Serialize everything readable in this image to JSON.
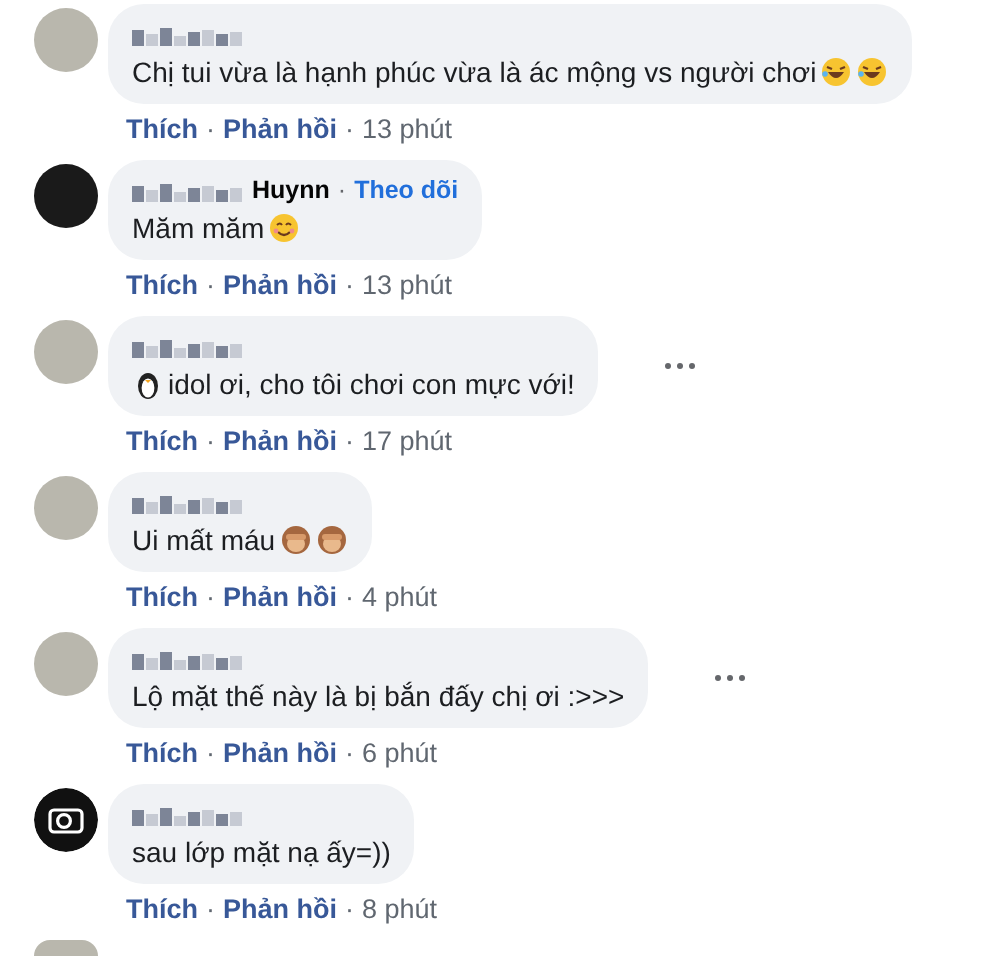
{
  "comments": [
    {
      "kind": "photo",
      "text": "Chị tui vừa là hạnh phúc vừa là ác mộng vs người chơi",
      "emojis": [
        {
          "kind": "rofl"
        },
        {
          "kind": "rofl"
        }
      ],
      "more": false,
      "actions": [
        {
          "kind": "link",
          "text": "Thích"
        },
        {
          "kind": "sep",
          "text": "·"
        },
        {
          "kind": "link",
          "text": "Phản hồi"
        },
        {
          "kind": "sep",
          "text": "·"
        },
        {
          "kind": "time",
          "text": "13 phút"
        }
      ]
    },
    {
      "kind": "dark",
      "name_visible": "Huynn",
      "follow_separator": "·",
      "follow": "Theo dõi",
      "text": "Măm măm",
      "emojis": [
        {
          "kind": "smile"
        }
      ],
      "more": false,
      "actions": [
        {
          "kind": "link",
          "text": "Thích"
        },
        {
          "kind": "sep",
          "text": "·"
        },
        {
          "kind": "link",
          "text": "Phản hồi"
        },
        {
          "kind": "sep",
          "text": "·"
        },
        {
          "kind": "time",
          "text": "13 phút"
        }
      ]
    },
    {
      "kind": "photo",
      "text": "idol ơi, cho tôi chơi con mực với!",
      "lead_emoji": [
        {
          "kind": "penguin"
        }
      ],
      "more": true,
      "actions": [
        {
          "kind": "link",
          "text": "Thích"
        },
        {
          "kind": "sep",
          "text": "·"
        },
        {
          "kind": "link",
          "text": "Phản hồi"
        },
        {
          "kind": "sep",
          "text": "·"
        },
        {
          "kind": "time",
          "text": "17 phút"
        }
      ]
    },
    {
      "kind": "photo",
      "text": "Ui mất máu",
      "emojis": [
        {
          "kind": "monkey"
        },
        {
          "kind": "monkey"
        }
      ],
      "more": false,
      "actions": [
        {
          "kind": "link",
          "text": "Thích"
        },
        {
          "kind": "sep",
          "text": "·"
        },
        {
          "kind": "link",
          "text": "Phản hồi"
        },
        {
          "kind": "sep",
          "text": "·"
        },
        {
          "kind": "time",
          "text": "4 phút"
        }
      ]
    },
    {
      "kind": "photo",
      "text": "Lộ mặt thế này là bị bắn đấy chị ơi :>>>",
      "more": true,
      "actions": [
        {
          "kind": "link",
          "text": "Thích"
        },
        {
          "kind": "sep",
          "text": "·"
        },
        {
          "kind": "link",
          "text": "Phản hồi"
        },
        {
          "kind": "sep",
          "text": "·"
        },
        {
          "kind": "time",
          "text": "6 phút"
        }
      ]
    },
    {
      "kind": "camera",
      "text": "sau lớp mặt nạ ấy=))",
      "more": false,
      "actions": [
        {
          "kind": "link",
          "text": "Thích"
        },
        {
          "kind": "sep",
          "text": "·"
        },
        {
          "kind": "link",
          "text": "Phản hồi"
        },
        {
          "kind": "sep",
          "text": "·"
        },
        {
          "kind": "time",
          "text": "8 phút"
        }
      ]
    }
  ]
}
